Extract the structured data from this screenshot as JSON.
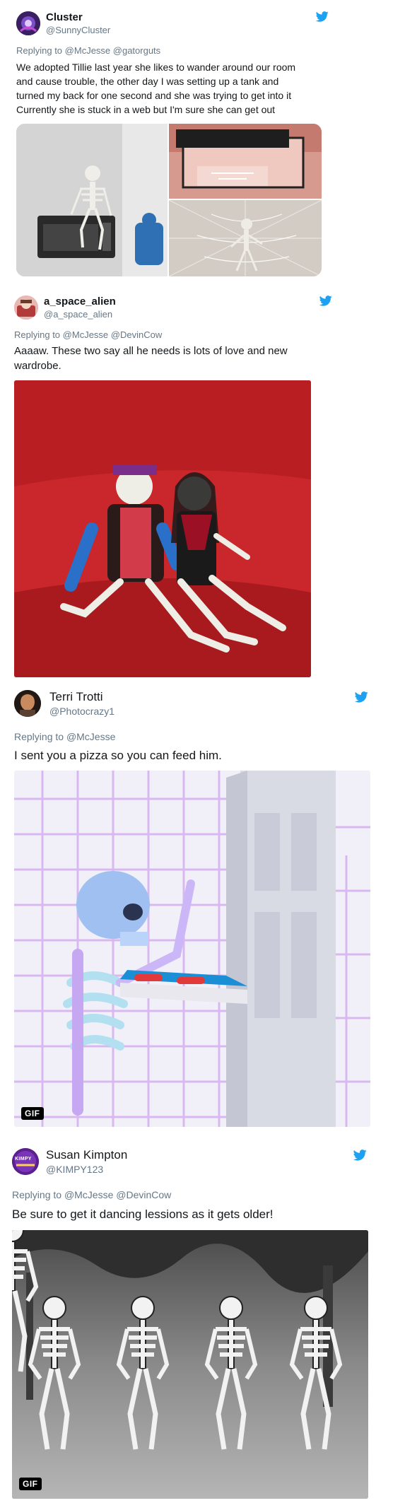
{
  "tweets": [
    {
      "display_name": "Cluster",
      "handle": "@SunnyCluster",
      "replying_prefix": "Replying to",
      "replying_to": "@McJesse @gatorguts",
      "lines": [
        "We adopted Tillie last year she likes to wander around our room",
        "and cause trouble, the other day I was setting up a tank and",
        "turned my back for one second and she was trying to get into it",
        "Currently she is stuck in a web but I'm sure she can get out"
      ],
      "media": [
        "skeleton-on-toaster-oven-photo",
        "skeleton-in-fish-tank-photo",
        "skeleton-in-spider-web-photo"
      ],
      "icon": "twitter-bird-icon"
    },
    {
      "display_name": "a_space_alien",
      "handle": "@a_space_alien",
      "replying_prefix": "Replying to",
      "replying_to": "@McJesse @DevinCow",
      "lines": [
        "Aaaaw. These two say all he needs is lots of love and new",
        "wardrobe."
      ],
      "media": [
        "two-dressed-skeletons-on-red-couch-photo"
      ],
      "icon": "twitter-bird-icon"
    },
    {
      "display_name": "Terri Trotti",
      "handle": "@Photocrazy1",
      "replying_prefix": "Replying to",
      "replying_to": "@McJesse",
      "lines": [
        "I sent you a pizza so you can feed him."
      ],
      "media": [
        "skeleton-delivering-pizza-gif"
      ],
      "gif_label": "GIF",
      "icon": "twitter-bird-icon"
    },
    {
      "display_name": "Susan Kimpton",
      "handle": "@KIMPY123",
      "replying_prefix": "Replying to",
      "replying_to": "@McJesse @DevinCow",
      "lines": [
        "Be sure to get it dancing lessions as it gets older!"
      ],
      "media": [
        "dancing-skeletons-cartoon-gif"
      ],
      "gif_label": "GIF",
      "avatar_text": "KIMPY",
      "icon": "twitter-bird-icon"
    }
  ],
  "colors": {
    "twitter_blue": "#1da1f2",
    "secondary_text": "#657786",
    "primary_text": "#14171a"
  }
}
